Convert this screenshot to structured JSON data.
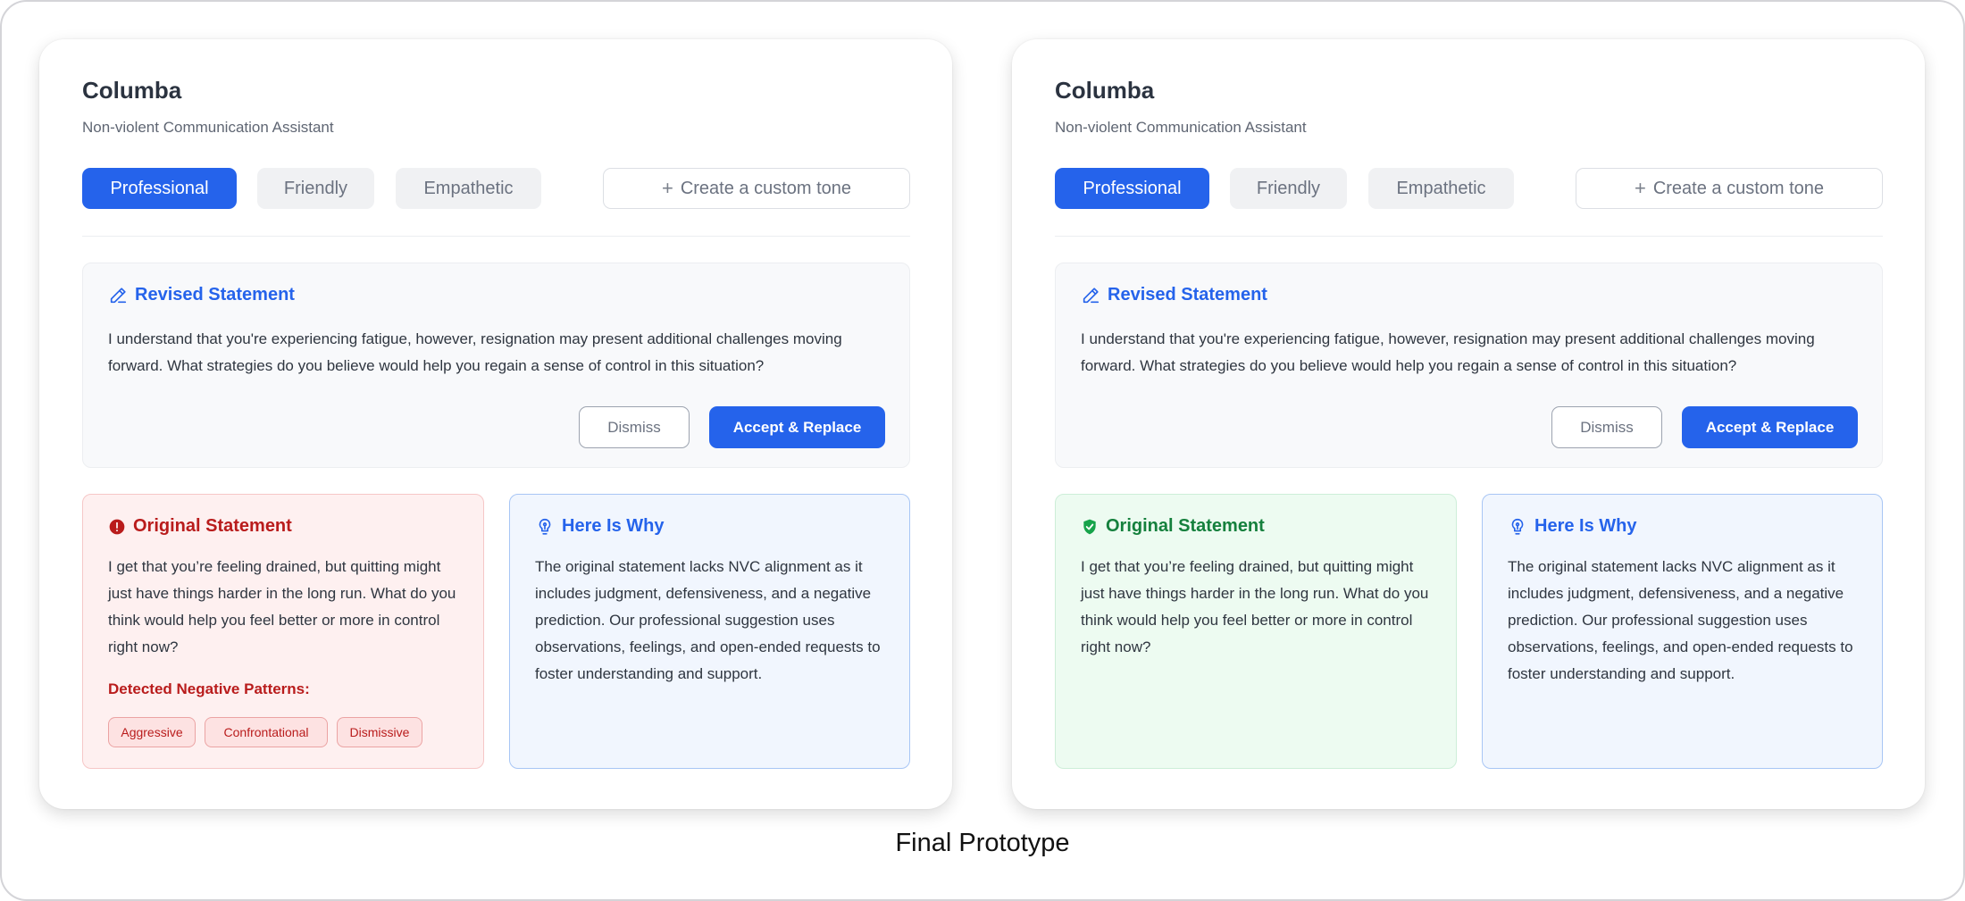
{
  "caption": "Final Prototype",
  "colors": {
    "accent": "#2563eb",
    "negative": "#b91c1c",
    "positive": "#15803d"
  },
  "cards": [
    {
      "app_title": "Columba",
      "app_subtitle": "Non-violent Communication Assistant",
      "tones": {
        "professional": "Professional",
        "friendly": "Friendly",
        "empathetic": "Empathetic",
        "custom": "Create a custom tone",
        "selected": "Professional"
      },
      "revised": {
        "title": "Revised Statement",
        "icon": "pencil-icon",
        "text": "I understand that you're experiencing fatigue, however, resignation may present additional challenges moving forward. What strategies do you believe would help you regain a sense of control in this situation?",
        "dismiss_label": "Dismiss",
        "accept_label": "Accept & Replace"
      },
      "original": {
        "title": "Original Statement",
        "icon": "alert-circle-icon",
        "text": "I get that you’re feeling drained, but quitting might just have things harder in the long run. What do you think would help you feel better or more in control right now?",
        "patterns_label": "Detected Negative Patterns:",
        "patterns": [
          "Aggressive",
          "Confrontational",
          "Dismissive"
        ]
      },
      "why": {
        "title": "Here Is Why",
        "icon": "lightbulb-icon",
        "text": "The original statement lacks NVC alignment as it includes judgment, defensiveness, and a negative prediction. Our professional suggestion uses observations, feelings, and open-ended requests to foster understanding and support."
      }
    },
    {
      "app_title": "Columba",
      "app_subtitle": "Non-violent Communication Assistant",
      "tones": {
        "professional": "Professional",
        "friendly": "Friendly",
        "empathetic": "Empathetic",
        "custom": "Create a custom tone",
        "selected": "Professional"
      },
      "revised": {
        "title": "Revised Statement",
        "icon": "pencil-icon",
        "text": "I understand that you're experiencing fatigue, however, resignation may present additional challenges moving forward. What strategies do you believe would help you regain a sense of control in this situation?",
        "dismiss_label": "Dismiss",
        "accept_label": "Accept & Replace"
      },
      "original": {
        "title": "Original Statement",
        "icon": "shield-check-icon",
        "text": "I get that you’re feeling drained, but quitting might just have things harder in the long run. What do you think would help you feel better or more in control right now?"
      },
      "why": {
        "title": "Here Is Why",
        "icon": "lightbulb-icon",
        "text": "The original statement lacks NVC alignment as it includes judgment, defensiveness, and a negative prediction. Our professional suggestion uses observations, feelings, and open-ended requests to foster understanding and support."
      }
    }
  ]
}
